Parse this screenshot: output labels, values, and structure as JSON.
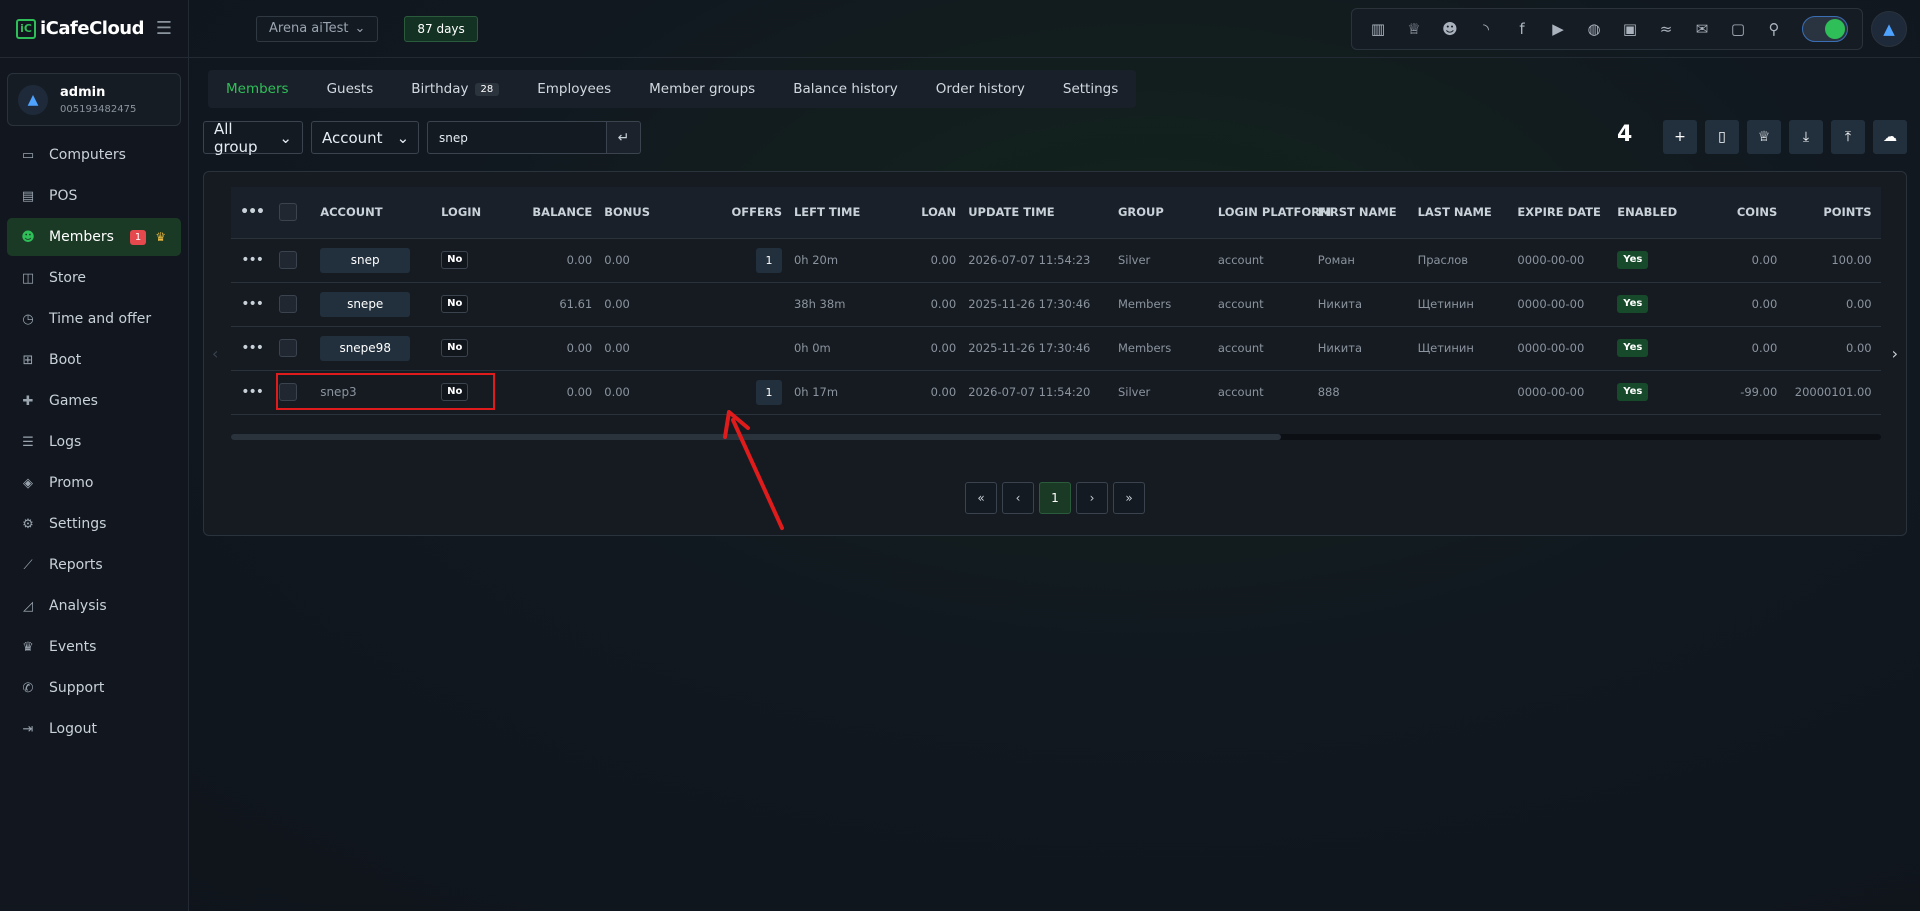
{
  "app": {
    "logo_mark": "iC",
    "logo_text": "iCafeCloud"
  },
  "user": {
    "name": "admin",
    "id": "005193482475"
  },
  "nav": [
    {
      "label": "Computers",
      "icon": "monitor-icon",
      "glyph": "▭"
    },
    {
      "label": "POS",
      "icon": "pos-icon",
      "glyph": "▤"
    },
    {
      "label": "Members",
      "icon": "members-icon",
      "glyph": "☻",
      "badge": "1",
      "active": true
    },
    {
      "label": "Store",
      "icon": "store-icon",
      "glyph": "◫"
    },
    {
      "label": "Time and offer",
      "icon": "clock-icon",
      "glyph": "◷"
    },
    {
      "label": "Boot",
      "icon": "windows-icon",
      "glyph": "⊞"
    },
    {
      "label": "Games",
      "icon": "gamepad-icon",
      "glyph": "✚"
    },
    {
      "label": "Logs",
      "icon": "list-icon",
      "glyph": "☰"
    },
    {
      "label": "Promo",
      "icon": "tag-icon",
      "glyph": "◈"
    },
    {
      "label": "Settings",
      "icon": "gear-icon",
      "glyph": "⚙"
    },
    {
      "label": "Reports",
      "icon": "line-chart-icon",
      "glyph": "⟋"
    },
    {
      "label": "Analysis",
      "icon": "area-chart-icon",
      "glyph": "◿"
    },
    {
      "label": "Events",
      "icon": "crown-icon",
      "glyph": "♛"
    },
    {
      "label": "Support",
      "icon": "phone-icon",
      "glyph": "✆"
    },
    {
      "label": "Logout",
      "icon": "logout-icon",
      "glyph": "⇥"
    }
  ],
  "topbar": {
    "store": "Arena aiTest",
    "days": "87 days",
    "icons": [
      "leaderboard-icon",
      "trophy-icon",
      "users-icon",
      "rss-icon",
      "facebook-icon",
      "youtube-icon",
      "globe-icon",
      "icafe-icon",
      "handshake-icon",
      "mail-icon",
      "chat-icon",
      "search-icon"
    ],
    "icon_glyphs": [
      "▥",
      "♕",
      "☻",
      "◝",
      "f",
      "▶",
      "◍",
      "▣",
      "≈",
      "✉",
      "▢",
      "⚲"
    ]
  },
  "tabs": [
    {
      "label": "Members",
      "active": true
    },
    {
      "label": "Guests"
    },
    {
      "label": "Birthday",
      "count": "28"
    },
    {
      "label": "Employees"
    },
    {
      "label": "Member groups"
    },
    {
      "label": "Balance history"
    },
    {
      "label": "Order history"
    },
    {
      "label": "Settings"
    }
  ],
  "filters": {
    "group": "All group",
    "field": "Account",
    "search_value": "snep"
  },
  "total_count": "4",
  "table": {
    "headers": [
      "ACCOUNT",
      "LOGIN",
      "BALANCE",
      "BONUS",
      "OFFERS",
      "LEFT TIME",
      "LOAN",
      "UPDATE TIME",
      "GROUP",
      "LOGIN PLATFORM",
      "FIRST NAME",
      "LAST NAME",
      "EXPIRE DATE",
      "ENABLED",
      "COINS",
      "POINTS"
    ],
    "rows": [
      {
        "account": "snep",
        "login": "No",
        "balance": "0.00",
        "bonus": "0.00",
        "offers": "1",
        "left_time": "0h 20m",
        "loan": "0.00",
        "update_time": "2026-07-07 11:54:23",
        "group": "Silver",
        "platform": "account",
        "first_name": "Роман",
        "last_name": "Праслов",
        "expire": "0000-00-00",
        "enabled": "Yes",
        "coins": "0.00",
        "points": "100.00"
      },
      {
        "account": "snepe",
        "login": "No",
        "balance": "61.61",
        "bonus": "0.00",
        "offers": "",
        "left_time": "38h 38m",
        "loan": "0.00",
        "update_time": "2025-11-26 17:30:46",
        "group": "Members",
        "platform": "account",
        "first_name": "Никита",
        "last_name": "Щетинин",
        "expire": "0000-00-00",
        "enabled": "Yes",
        "coins": "0.00",
        "points": "0.00"
      },
      {
        "account": "snepe98",
        "login": "No",
        "balance": "0.00",
        "bonus": "0.00",
        "offers": "",
        "left_time": "0h 0m",
        "loan": "0.00",
        "update_time": "2025-11-26 17:30:46",
        "group": "Members",
        "platform": "account",
        "first_name": "Никита",
        "last_name": "Щетинин",
        "expire": "0000-00-00",
        "enabled": "Yes",
        "coins": "0.00",
        "points": "0.00"
      },
      {
        "account": "snep3",
        "login": "No",
        "balance": "0.00",
        "bonus": "0.00",
        "offers": "1",
        "left_time": "0h 17m",
        "loan": "0.00",
        "update_time": "2026-07-07 11:54:20",
        "group": "Silver",
        "platform": "account",
        "first_name": "888",
        "last_name": "",
        "expire": "0000-00-00",
        "enabled": "Yes",
        "coins": "-99.00",
        "points": "20000101.00",
        "plain": true
      }
    ]
  },
  "pager": [
    "«",
    "‹",
    "1",
    "›",
    "»"
  ]
}
